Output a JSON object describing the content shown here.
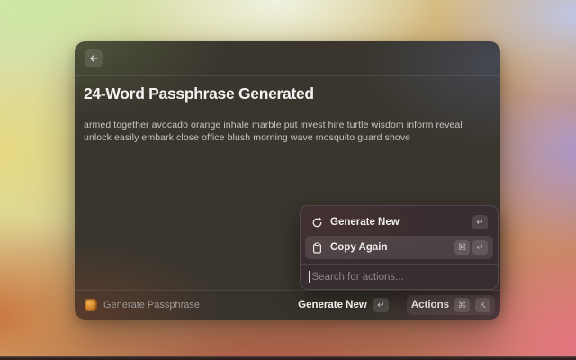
{
  "window": {
    "title": "24-Word Passphrase Generated",
    "passphrase": "armed together avocado orange inhale marble put invest hire turtle wisdom inform reveal unlock easily embark close office blush morning wave mosquito guard shove"
  },
  "actions_panel": {
    "items": [
      {
        "label": "Generate New",
        "icon": "refresh-icon",
        "shortcut": [
          "↵"
        ],
        "selected": false
      },
      {
        "label": "Copy Again",
        "icon": "clipboard-icon",
        "shortcut": [
          "⌘",
          "↵"
        ],
        "selected": true
      }
    ],
    "search_placeholder": "Search for actions..."
  },
  "footer": {
    "app_name": "Generate Passphrase",
    "primary_action": {
      "label": "Generate New",
      "shortcut": [
        "↵"
      ]
    },
    "actions_menu": {
      "label": "Actions",
      "shortcut": [
        "⌘",
        "K"
      ]
    }
  },
  "colors": {
    "app_icon_orange": "#d98a2e",
    "selection_highlight": "#ffffff1a",
    "window_tint_topleft": "#3f4534",
    "window_tint_topright": "#3a3c44",
    "window_tint_bottomleft": "#46352c",
    "window_tint_bottomright": "#3a2e33"
  }
}
